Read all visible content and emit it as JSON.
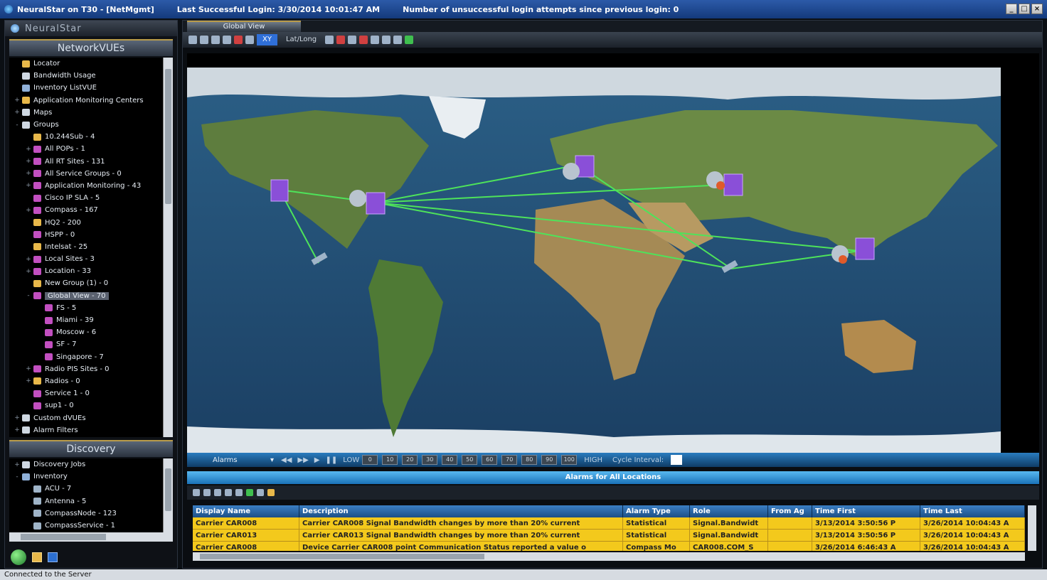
{
  "titlebar": {
    "app": "NeuralStar on T30 - [NetMgmt]",
    "login": "Last Successful Login: 3/30/2014 10:01:47 AM",
    "attempts": "Number of unsuccessful login attempts since previous login: 0"
  },
  "brand": "NeuralStar",
  "networkvues": {
    "header": "NetworkVUEs",
    "items": [
      {
        "label": "Locator",
        "level": 0,
        "exp": "",
        "icon": "folder-icon"
      },
      {
        "label": "Bandwidth Usage",
        "level": 0,
        "exp": "",
        "icon": "tool-icon"
      },
      {
        "label": "Inventory ListVUE",
        "level": 0,
        "exp": "",
        "icon": "node-icon"
      },
      {
        "label": "Application Monitoring Centers",
        "level": 0,
        "exp": "+",
        "icon": "folder-icon"
      },
      {
        "label": "Maps",
        "level": 0,
        "exp": "+",
        "icon": "tool-icon"
      },
      {
        "label": "Groups",
        "level": 0,
        "exp": "-",
        "icon": "tool-icon"
      },
      {
        "label": "10.244Sub - 4",
        "level": 1,
        "exp": "",
        "icon": "folder-icon"
      },
      {
        "label": "All POPs - 1",
        "level": 1,
        "exp": "+",
        "icon": "group-icon"
      },
      {
        "label": "All RT Sites - 131",
        "level": 1,
        "exp": "+",
        "icon": "group-icon"
      },
      {
        "label": "All Service Groups - 0",
        "level": 1,
        "exp": "+",
        "icon": "group-icon"
      },
      {
        "label": "Application Monitoring - 43",
        "level": 1,
        "exp": "+",
        "icon": "group-icon"
      },
      {
        "label": "Cisco IP SLA - 5",
        "level": 1,
        "exp": "",
        "icon": "group-icon"
      },
      {
        "label": "Compass - 167",
        "level": 1,
        "exp": "+",
        "icon": "group-icon"
      },
      {
        "label": "HQ2 - 200",
        "level": 1,
        "exp": "",
        "icon": "folder-icon"
      },
      {
        "label": "HSPP - 0",
        "level": 1,
        "exp": "",
        "icon": "group-icon"
      },
      {
        "label": "Intelsat - 25",
        "level": 1,
        "exp": "",
        "icon": "folder-icon"
      },
      {
        "label": "Local Sites - 3",
        "level": 1,
        "exp": "+",
        "icon": "group-icon"
      },
      {
        "label": "Location - 33",
        "level": 1,
        "exp": "+",
        "icon": "group-icon"
      },
      {
        "label": "New Group (1) - 0",
        "level": 1,
        "exp": "",
        "icon": "folder-icon"
      },
      {
        "label": "Global View - 70",
        "level": 1,
        "exp": "-",
        "icon": "group-icon",
        "selected": true
      },
      {
        "label": "FS - 5",
        "level": 2,
        "exp": "",
        "icon": "group-icon"
      },
      {
        "label": "Miami - 39",
        "level": 2,
        "exp": "",
        "icon": "group-icon"
      },
      {
        "label": "Moscow - 6",
        "level": 2,
        "exp": "",
        "icon": "group-icon"
      },
      {
        "label": "SF - 7",
        "level": 2,
        "exp": "",
        "icon": "group-icon"
      },
      {
        "label": "Singapore - 7",
        "level": 2,
        "exp": "",
        "icon": "group-icon"
      },
      {
        "label": "Radio PIS Sites - 0",
        "level": 1,
        "exp": "+",
        "icon": "group-icon"
      },
      {
        "label": "Radios - 0",
        "level": 1,
        "exp": "+",
        "icon": "folder-icon"
      },
      {
        "label": "Service 1 - 0",
        "level": 1,
        "exp": "",
        "icon": "group-icon"
      },
      {
        "label": "sup1 - 0",
        "level": 1,
        "exp": "",
        "icon": "group-icon"
      },
      {
        "label": "Custom dVUEs",
        "level": 0,
        "exp": "+",
        "icon": "tool-icon"
      },
      {
        "label": "Alarm Filters",
        "level": 0,
        "exp": "+",
        "icon": "tool-icon"
      }
    ]
  },
  "discovery": {
    "header": "Discovery",
    "items": [
      {
        "label": "Discovery Jobs",
        "level": 0,
        "exp": "+",
        "icon": "tool-icon"
      },
      {
        "label": "Inventory",
        "level": 0,
        "exp": "-",
        "icon": "node-icon"
      },
      {
        "label": "ACU - 7",
        "level": 1,
        "exp": "",
        "icon": "sat-icon"
      },
      {
        "label": "Antenna - 5",
        "level": 1,
        "exp": "",
        "icon": "sat-icon"
      },
      {
        "label": "CompassNode - 123",
        "level": 1,
        "exp": "",
        "icon": "sat-icon"
      },
      {
        "label": "CompassService - 1",
        "level": 1,
        "exp": "",
        "icon": "sat-icon"
      }
    ]
  },
  "tab": {
    "label": "Global View"
  },
  "toolbar": {
    "xy": "XY",
    "latlong": "Lat/Long"
  },
  "alarm_ctrl": {
    "select": "Alarms",
    "low": "LOW",
    "high": "HIGH",
    "levels": [
      "0",
      "10",
      "20",
      "30",
      "40",
      "50",
      "60",
      "70",
      "80",
      "90",
      "100"
    ],
    "cycle_label": "Cycle Interval:"
  },
  "alarms_title": "Alarms for All Locations",
  "grid": {
    "headers": [
      "Display Name",
      "Description",
      "Alarm Type",
      "Role",
      "From Ag",
      "Time First",
      "Time Last"
    ],
    "rows": [
      [
        "Carrier CAR008",
        "Carrier CAR008 Signal Bandwidth changes by more than 20% current",
        "Statistical",
        "Signal.Bandwidt",
        "",
        "3/13/2014 3:50:56 P",
        "3/26/2014 10:04:43 A"
      ],
      [
        "Carrier CAR013",
        "Carrier CAR013 Signal Bandwidth changes by more than 20% current",
        "Statistical",
        "Signal.Bandwidt",
        "",
        "3/13/2014 3:50:56 P",
        "3/26/2014 10:04:43 A"
      ],
      [
        "Carrier CAR008",
        "Device Carrier CAR008 point Communication Status reported a value o",
        "Compass Mo",
        "CAR008.COM_S",
        "",
        "3/26/2014 6:46:43 A",
        "3/26/2014 10:04:43 A"
      ]
    ]
  },
  "status": "Connected to the Server",
  "colors": {
    "accent": "#2f6fd8",
    "alarm_row": "#f3c91c",
    "link": "#4ee35a",
    "site": "#8a4fd8"
  }
}
